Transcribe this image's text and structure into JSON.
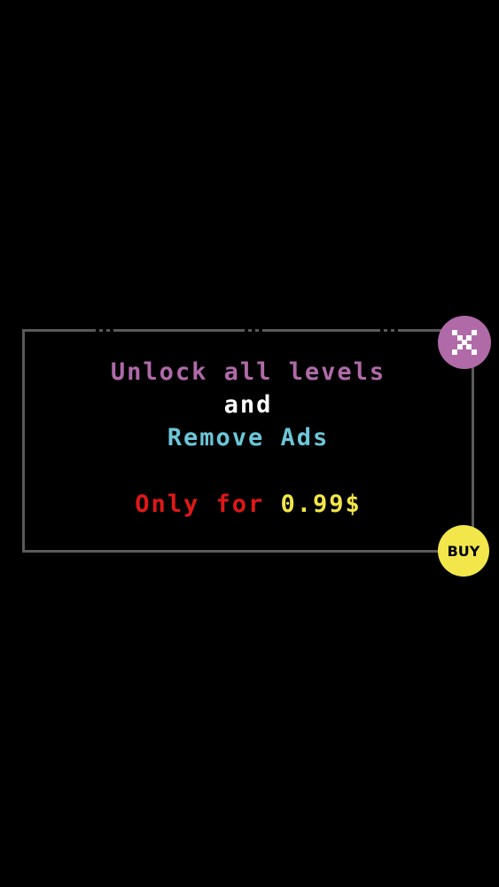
{
  "offer": {
    "line1": "Unlock all levels",
    "line2": "and",
    "line3": "Remove Ads",
    "price_prefix": "Only for",
    "price_value": "0.99$"
  },
  "buttons": {
    "close_icon": "close-x-icon",
    "buy_label": "BUY"
  },
  "colors": {
    "background": "#000000",
    "panel_border": "#5a5a5a",
    "line1": "#b06aa8",
    "line2": "#ffffff",
    "line3": "#6cc6d8",
    "price_prefix": "#e01818",
    "price_value": "#f2e64a",
    "close_bg": "#b06aa8",
    "close_x": "#ffffff",
    "buy_bg": "#f2e64a",
    "buy_text": "#000000"
  }
}
